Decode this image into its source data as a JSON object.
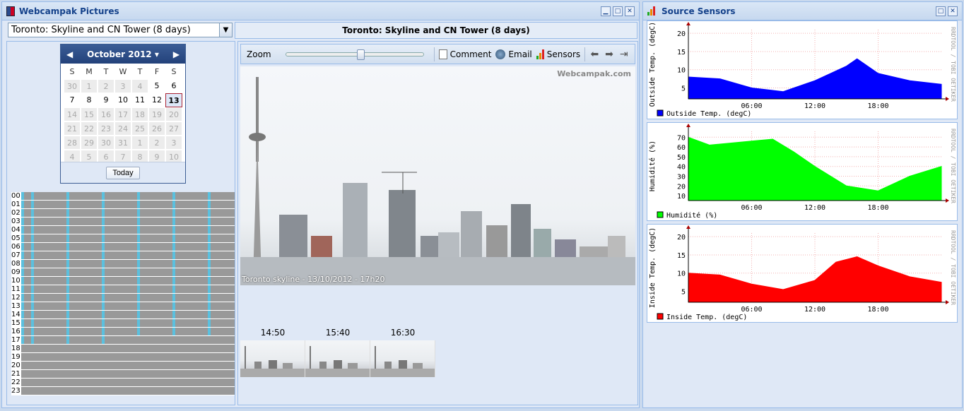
{
  "left_panel": {
    "title": "Webcampak Pictures",
    "source_select": "Toronto: Skyline and CN Tower (8 days)",
    "header_title": "Toronto: Skyline and CN Tower (8 days)"
  },
  "calendar": {
    "month_label": "October 2012",
    "dow": [
      "S",
      "M",
      "T",
      "W",
      "T",
      "F",
      "S"
    ],
    "rows": [
      [
        [
          "30",
          1
        ],
        [
          "1",
          1
        ],
        [
          "2",
          1
        ],
        [
          "3",
          1
        ],
        [
          "4",
          1
        ],
        [
          "5",
          0
        ],
        [
          "6",
          0
        ]
      ],
      [
        [
          "7",
          0
        ],
        [
          "8",
          0
        ],
        [
          "9",
          0
        ],
        [
          "10",
          0
        ],
        [
          "11",
          0
        ],
        [
          "12",
          0
        ],
        [
          "13",
          2
        ]
      ],
      [
        [
          "14",
          1
        ],
        [
          "15",
          1
        ],
        [
          "16",
          1
        ],
        [
          "17",
          1
        ],
        [
          "18",
          1
        ],
        [
          "19",
          1
        ],
        [
          "20",
          1
        ]
      ],
      [
        [
          "21",
          1
        ],
        [
          "22",
          1
        ],
        [
          "23",
          1
        ],
        [
          "24",
          1
        ],
        [
          "25",
          1
        ],
        [
          "26",
          1
        ],
        [
          "27",
          1
        ]
      ],
      [
        [
          "28",
          1
        ],
        [
          "29",
          1
        ],
        [
          "30",
          1
        ],
        [
          "31",
          1
        ],
        [
          "1",
          1
        ],
        [
          "2",
          1
        ],
        [
          "3",
          1
        ]
      ],
      [
        [
          "4",
          1
        ],
        [
          "5",
          1
        ],
        [
          "6",
          1
        ],
        [
          "7",
          1
        ],
        [
          "8",
          1
        ],
        [
          "9",
          1
        ],
        [
          "10",
          1
        ]
      ]
    ],
    "today_label": "Today"
  },
  "hours": [
    "00",
    "01",
    "02",
    "03",
    "04",
    "05",
    "06",
    "07",
    "08",
    "09",
    "10",
    "11",
    "12",
    "13",
    "14",
    "15",
    "16",
    "17",
    "18",
    "19",
    "20",
    "21",
    "22",
    "23"
  ],
  "hour_last_active": 17,
  "toolbar": {
    "zoom_label": "Zoom",
    "comment_label": "Comment",
    "email_label": "Email",
    "sensors_label": "Sensors"
  },
  "photo": {
    "caption": "Toronto skyline - 13/10/2012 - 17h20",
    "watermark": "Webcampak.com"
  },
  "thumbnails": [
    "14:50",
    "15:40",
    "16:30"
  ],
  "right_panel": {
    "title": "Source Sensors"
  },
  "charts": [
    {
      "ylabel": "Outside Temp. (degC)",
      "legend": "Outside Temp. (degC)",
      "color": "#0000ff",
      "side_label": "RRDTOOL / TOBI OETIKER",
      "yticks": [
        "20",
        "15",
        "10",
        "5"
      ],
      "ymin": 2,
      "ymax": 21,
      "xticks": [
        "06:00",
        "12:00",
        "18:00"
      ],
      "chart_data": {
        "type": "area",
        "x": [
          "00",
          "03",
          "06",
          "09",
          "12",
          "15",
          "16",
          "18",
          "21",
          "24"
        ],
        "values": [
          8,
          7.5,
          5,
          4,
          7,
          11,
          13,
          9,
          7,
          6
        ]
      }
    },
    {
      "ylabel": "Humidité (%)",
      "legend": "Humidité (%)",
      "color": "#00ff00",
      "side_label": "RRDTOOL / TOBI OETIKER",
      "yticks": [
        "70",
        "60",
        "50",
        "40",
        "30",
        "20",
        "10"
      ],
      "ymin": 5,
      "ymax": 76,
      "xticks": [
        "06:00",
        "12:00",
        "18:00"
      ],
      "chart_data": {
        "type": "area",
        "x": [
          "00",
          "02",
          "06",
          "08",
          "10",
          "12",
          "15",
          "18",
          "21",
          "24"
        ],
        "values": [
          70,
          62,
          66,
          68,
          55,
          40,
          20,
          15,
          30,
          40
        ]
      }
    },
    {
      "ylabel": "Inside Temp. (degC)",
      "legend": "Inside Temp. (degC)",
      "color": "#ff0000",
      "side_label": "RRDTOOL / TOBI OETIKER",
      "yticks": [
        "20",
        "15",
        "10",
        "5"
      ],
      "ymin": 2,
      "ymax": 21,
      "xticks": [
        "06:00",
        "12:00",
        "18:00"
      ],
      "chart_data": {
        "type": "area",
        "x": [
          "00",
          "03",
          "06",
          "09",
          "12",
          "14",
          "16",
          "18",
          "21",
          "24"
        ],
        "values": [
          10,
          9.5,
          7,
          5.5,
          8,
          13,
          14.5,
          12,
          9,
          7.5
        ]
      }
    }
  ]
}
